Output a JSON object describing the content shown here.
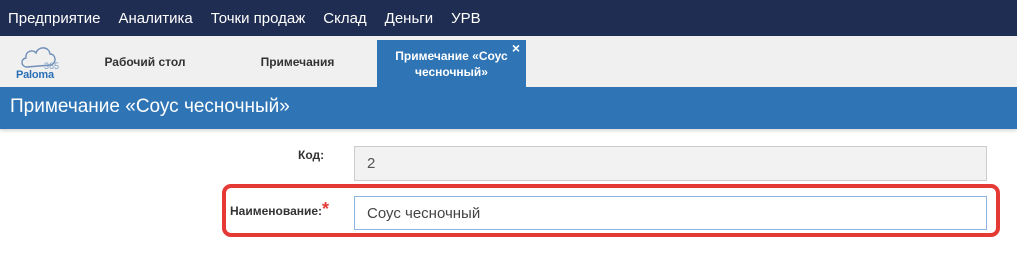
{
  "topnav": {
    "items": [
      "Предприятие",
      "Аналитика",
      "Точки продаж",
      "Склад",
      "Деньги",
      "УРВ"
    ]
  },
  "logo": {
    "text": "Paloma",
    "number": "365"
  },
  "tabs": {
    "items": [
      "Рабочий стол",
      "Примечания"
    ],
    "active": {
      "label": "Примечание «Соус чесночный»",
      "close": "×"
    }
  },
  "page": {
    "title": "Примечание «Соус чесночный»"
  },
  "form": {
    "code_label": "Код:",
    "code_value": "2",
    "name_label": "Наименование:",
    "required_mark": "*",
    "name_value": "Соус чесночный"
  },
  "colors": {
    "topnav_bg": "#1f2d52",
    "accent": "#2f75b5",
    "highlight": "#e53935"
  }
}
